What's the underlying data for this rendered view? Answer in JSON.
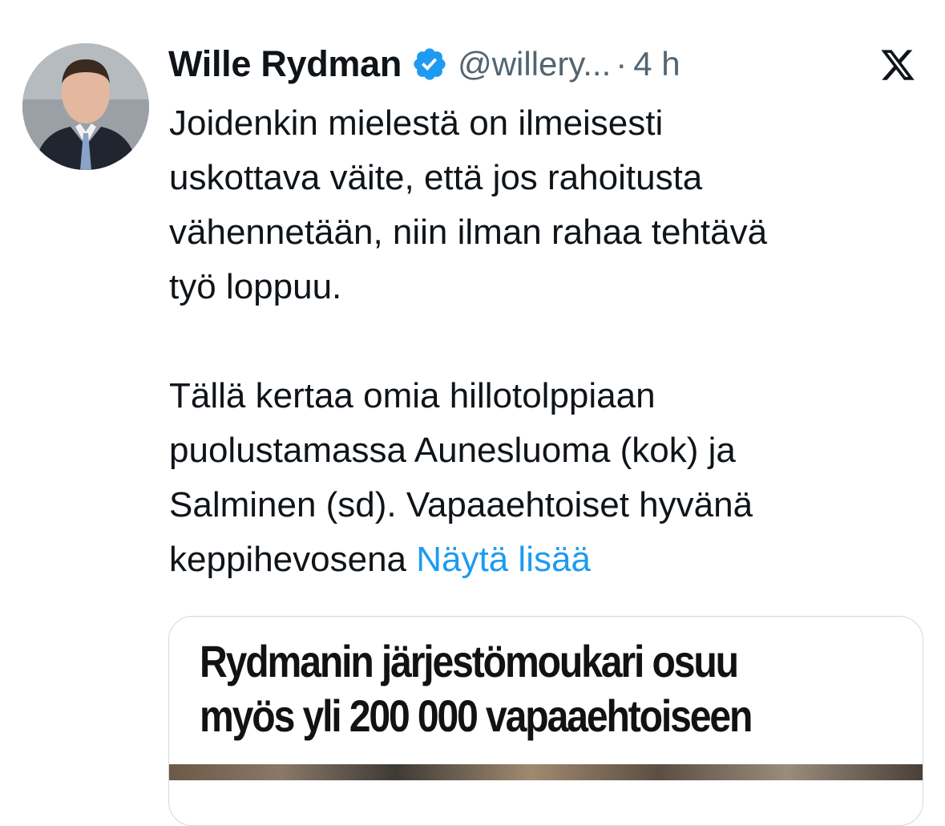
{
  "tweet": {
    "author_name": "Wille Rydman",
    "handle": "@willery...",
    "separator": "·",
    "time": "4 h",
    "verified_icon": "verified-badge-icon",
    "platform_icon": "x-logo-icon",
    "body_lines_para1": [
      "Joidenkin mielestä on ilmeisesti",
      "uskottava väite, että jos rahoitusta",
      "vähennetään, niin ilman rahaa tehtävä",
      "työ loppuu."
    ],
    "body_lines_para2": [
      "Tällä kertaa omia hillotolppiaan",
      "puolustamassa Aunesluoma (kok) ja",
      "Salminen (sd). Vapaaehtoiset hyvänä",
      "keppihevosena"
    ],
    "show_more": "Näytä lisää"
  },
  "card": {
    "headline_line1": "Rydmanin järjestömoukari osuu",
    "headline_line2": "myös yli 200 000 vapaaehtoiseen"
  },
  "colors": {
    "text": "#0f1419",
    "secondary": "#536471",
    "link": "#1d9bf0",
    "verified": "#1d9bf0",
    "border": "#cfd9de"
  }
}
